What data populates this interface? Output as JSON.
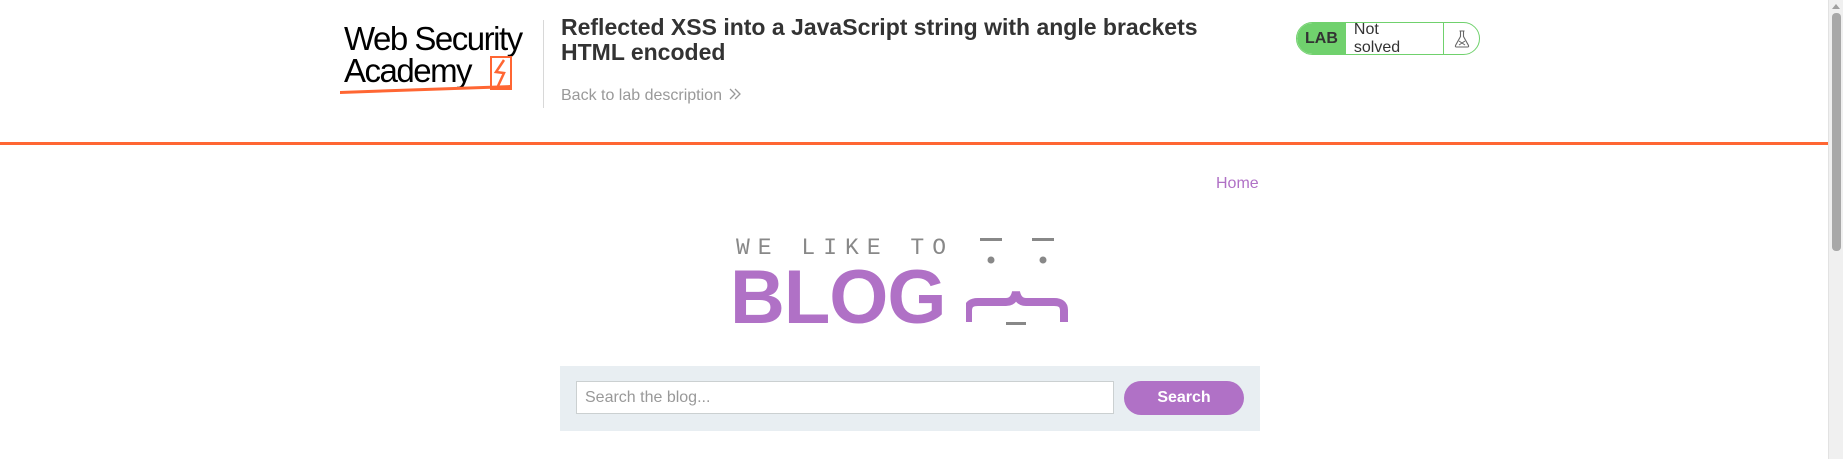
{
  "header": {
    "logo": {
      "line1": "Web Security",
      "line2": "Academy"
    },
    "lab_title": "Reflected XSS into a JavaScript string with angle brackets HTML encoded",
    "back_link": "Back to lab description",
    "lab_badge": "LAB",
    "lab_status": "Not solved",
    "icons": {
      "back": "double-chevron-right-icon",
      "flask": "flask-icon",
      "logo_bolt": "lightning-bolt-icon"
    }
  },
  "nav": {
    "home": "Home"
  },
  "blog_logo": {
    "tagline": "WE LIKE TO",
    "word": "BLOG"
  },
  "search": {
    "placeholder": "Search the blog...",
    "value": "",
    "button_label": "Search"
  },
  "colors": {
    "accent_orange": "#ff6633",
    "blog_purple": "#b071c6",
    "lab_green": "#70d16d",
    "search_panel_bg": "#e8eef2"
  }
}
